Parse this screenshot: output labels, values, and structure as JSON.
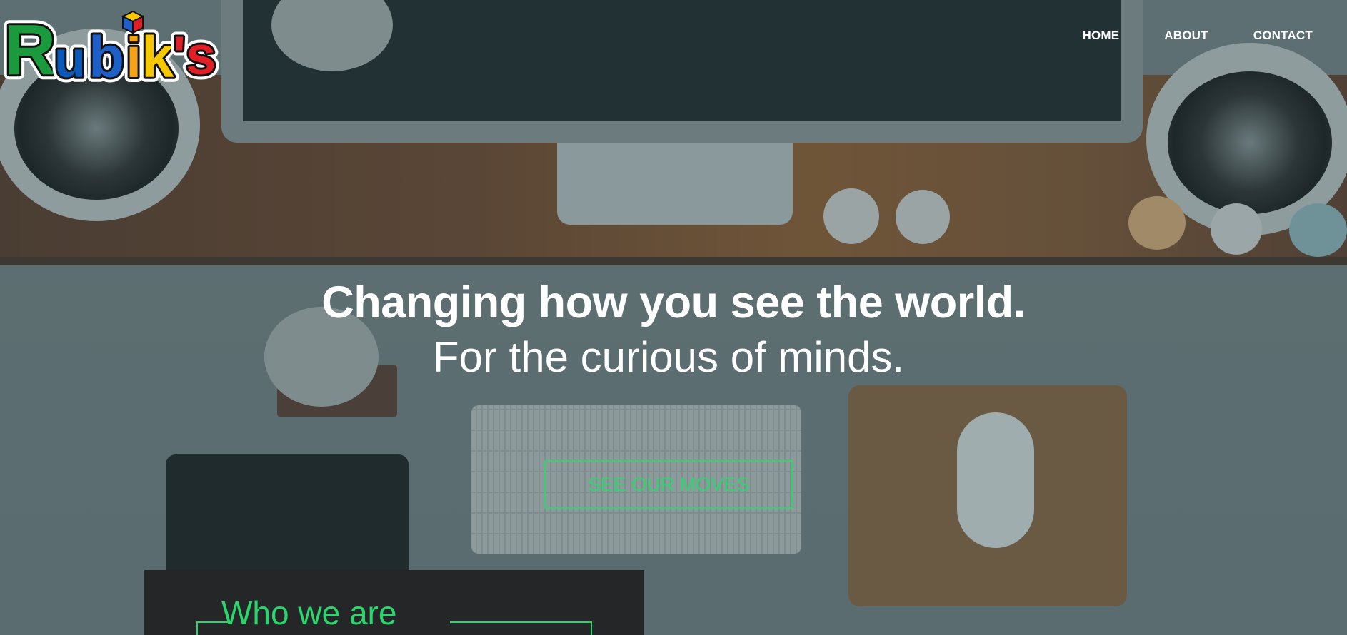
{
  "brand": {
    "name": "Rubik's",
    "letters": [
      "R",
      "u",
      "b",
      "i",
      "k",
      "'s"
    ],
    "colors": [
      "#1a9a3c",
      "#0a58b8",
      "#1e5fc8",
      "#f5a21b",
      "#f5c800",
      "#e01f26"
    ]
  },
  "nav": {
    "items": [
      {
        "label": "HOME"
      },
      {
        "label": "ABOUT"
      },
      {
        "label": "CONTACT"
      }
    ]
  },
  "hero": {
    "headline": "Changing how you see the world.",
    "subline": "For the curious of minds.",
    "cta_label": "SEE OUR MOVES",
    "accent_color": "#2bd66c"
  },
  "about": {
    "title": "Who we are"
  }
}
